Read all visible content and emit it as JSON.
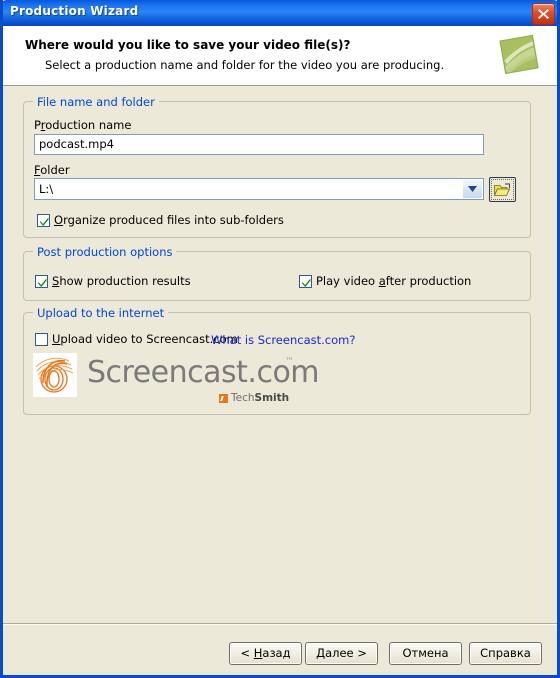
{
  "window": {
    "title": "Production Wizard",
    "close_icon": "close-icon"
  },
  "header": {
    "title": "Where would you like to save your video file(s)?",
    "subtitle": "Select a production name and folder for the video you are producing.",
    "icon": "video-file-icon"
  },
  "groups": {
    "file": {
      "legend": "File name and folder",
      "production_name": {
        "label_pre": "P",
        "label_acc": "r",
        "label_post": "oduction name",
        "value": "podcast.mp4",
        "placeholder": ""
      },
      "folder": {
        "label_pre": "",
        "label_acc": "F",
        "label_post": "older",
        "value": "L:\\",
        "dropdown_icon": "chevron-down-icon",
        "browse_icon": "open-folder-icon"
      },
      "organize_checkbox": {
        "pre": "",
        "acc": "O",
        "post": "rganize produced files into sub-folders",
        "checked": true
      }
    },
    "post_production": {
      "legend": "Post production options",
      "show_results": {
        "pre": "",
        "acc": "S",
        "post": "how production results",
        "checked": true
      },
      "play_video": {
        "pre": "Play video ",
        "acc": "a",
        "post": "fter production",
        "checked": true
      }
    },
    "upload": {
      "legend": "Upload to the internet",
      "upload_checkbox": {
        "pre": "",
        "acc": "U",
        "post": "pload video to Screencast.com",
        "checked": false
      },
      "link_text": "What is Screencast.com?",
      "brand": {
        "wordmark": "Screencast.com",
        "trademark": "™",
        "logo_icon": "screencast-swirl-icon",
        "techsmith_light": "Tech",
        "techsmith_bold": "Smith",
        "techsmith_icon": "techsmith-mark-icon"
      }
    }
  },
  "footer": {
    "back": "< Назад",
    "back_pre": "< ",
    "back_acc": "Н",
    "back_post": "азад",
    "next_pre": "",
    "next_acc": "Д",
    "next_post": "алее >",
    "cancel": "Отмена",
    "help": "Справка"
  },
  "colors": {
    "titlebar_blue": "#0A4BC8",
    "dialog_bg": "#ECE9D8",
    "legend_blue": "#0046D5",
    "link_blue": "#1B27D4",
    "check_green": "#13820C",
    "brand_orange": "#E8761B"
  }
}
